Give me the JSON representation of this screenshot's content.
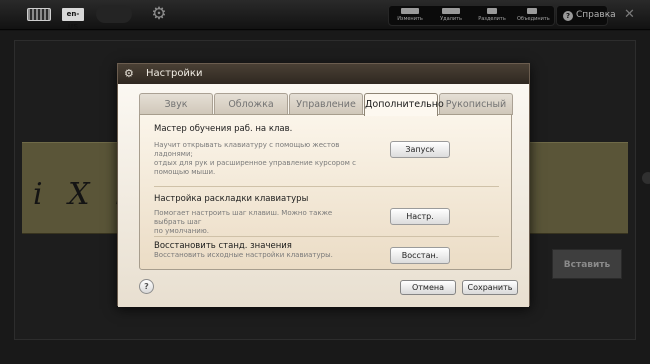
{
  "toolbar": {
    "lang": "en-US",
    "icons": {
      "keyboard": "keyboard-icon",
      "settings": "gear-icon"
    },
    "tools": [
      {
        "label": "Изменить"
      },
      {
        "label": "Удалить"
      },
      {
        "label": "Разделить"
      },
      {
        "label": "Объединить"
      }
    ],
    "help_label": "Справка",
    "close_glyph": "✕"
  },
  "workspace": {
    "handwriting": "i X b",
    "insert_label": "Вставить",
    "strip_color": "#5a5538"
  },
  "dialog": {
    "title": "Настройки",
    "tabs": [
      {
        "label": "Звук",
        "active": false
      },
      {
        "label": "Обложка",
        "active": false
      },
      {
        "label": "Управление",
        "active": false
      },
      {
        "label": "Дополнительно",
        "active": true
      },
      {
        "label": "Рукописный",
        "active": false
      }
    ],
    "sections": [
      {
        "title": "Мастер обучения раб. на клав.",
        "desc_lines": [
          "Научит открывать клавиатуру с помощью жестов ладонями;",
          "отдых для рук и расширенное управление курсором с",
          "помощью мыши."
        ],
        "button": "Запуск"
      },
      {
        "title": "Настройка раскладки клавиатуры",
        "desc_lines": [
          "Помогает настроить шаг клавиш. Можно также выбрать шаг",
          "по умолчанию."
        ],
        "button": "Настр."
      },
      {
        "title": "Восстановить станд. значения",
        "desc_lines": [
          "Восстановить исходные настройки клавиатуры."
        ],
        "button": "Восстан."
      }
    ],
    "help_glyph": "?",
    "cancel_label": "Отмена",
    "save_label": "Сохранить"
  }
}
